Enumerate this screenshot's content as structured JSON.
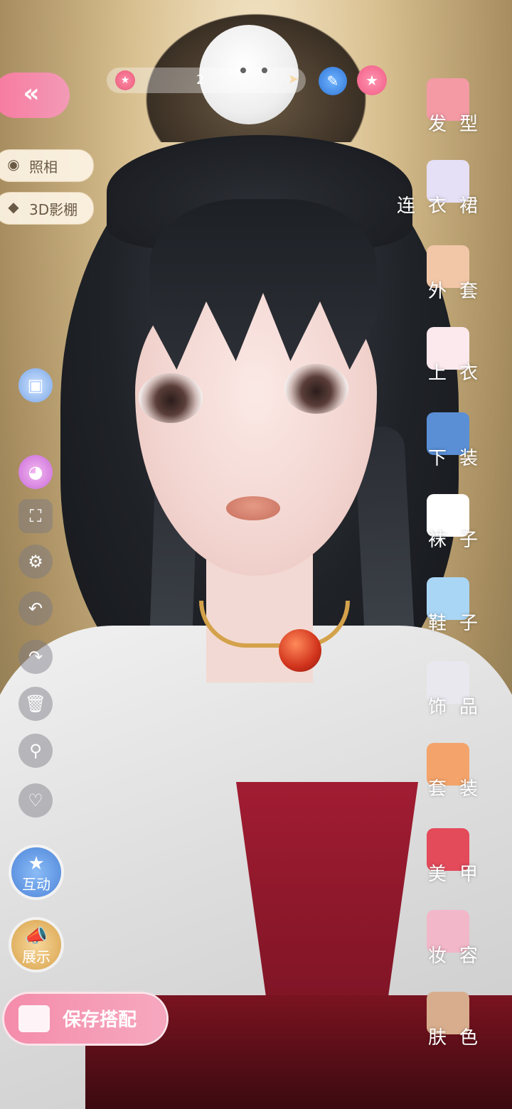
{
  "top_bar": {
    "count": "2"
  },
  "left_panel": {
    "photo_label": "照相",
    "studio_label": "3D影棚",
    "interact_label": "互动",
    "show_label": "展示",
    "save_label": "保存搭配"
  },
  "categories": [
    {
      "label": "发型",
      "icon": "hair-icon",
      "color": "#f39aa5"
    },
    {
      "label": "连衣裙",
      "icon": "dress-icon",
      "color": "#e6e0f6"
    },
    {
      "label": "外套",
      "icon": "coat-icon",
      "color": "#f2c7a8"
    },
    {
      "label": "上衣",
      "icon": "shirt-icon",
      "color": "#fbe9ee"
    },
    {
      "label": "下装",
      "icon": "shorts-icon",
      "color": "#5a8fd6"
    },
    {
      "label": "袜子",
      "icon": "sock-icon",
      "color": "#ffffff"
    },
    {
      "label": "鞋子",
      "icon": "shoe-icon",
      "color": "#a9d6f5"
    },
    {
      "label": "饰品",
      "icon": "tiara-icon",
      "color": "#e8e8ee"
    },
    {
      "label": "套装",
      "icon": "outfit-icon",
      "color": "#f4a46b"
    },
    {
      "label": "美甲",
      "icon": "nail-polish-icon",
      "color": "#e34a5a"
    },
    {
      "label": "妆容",
      "icon": "makeup-icon",
      "color": "#f2b7c8"
    },
    {
      "label": "肤色",
      "icon": "skin-palette-icon",
      "color": "#d8ad8d"
    }
  ],
  "colors": {
    "accent_pink": "#f48cab",
    "robe": "#e6e6e6",
    "inner_robe": "#a11c32"
  }
}
